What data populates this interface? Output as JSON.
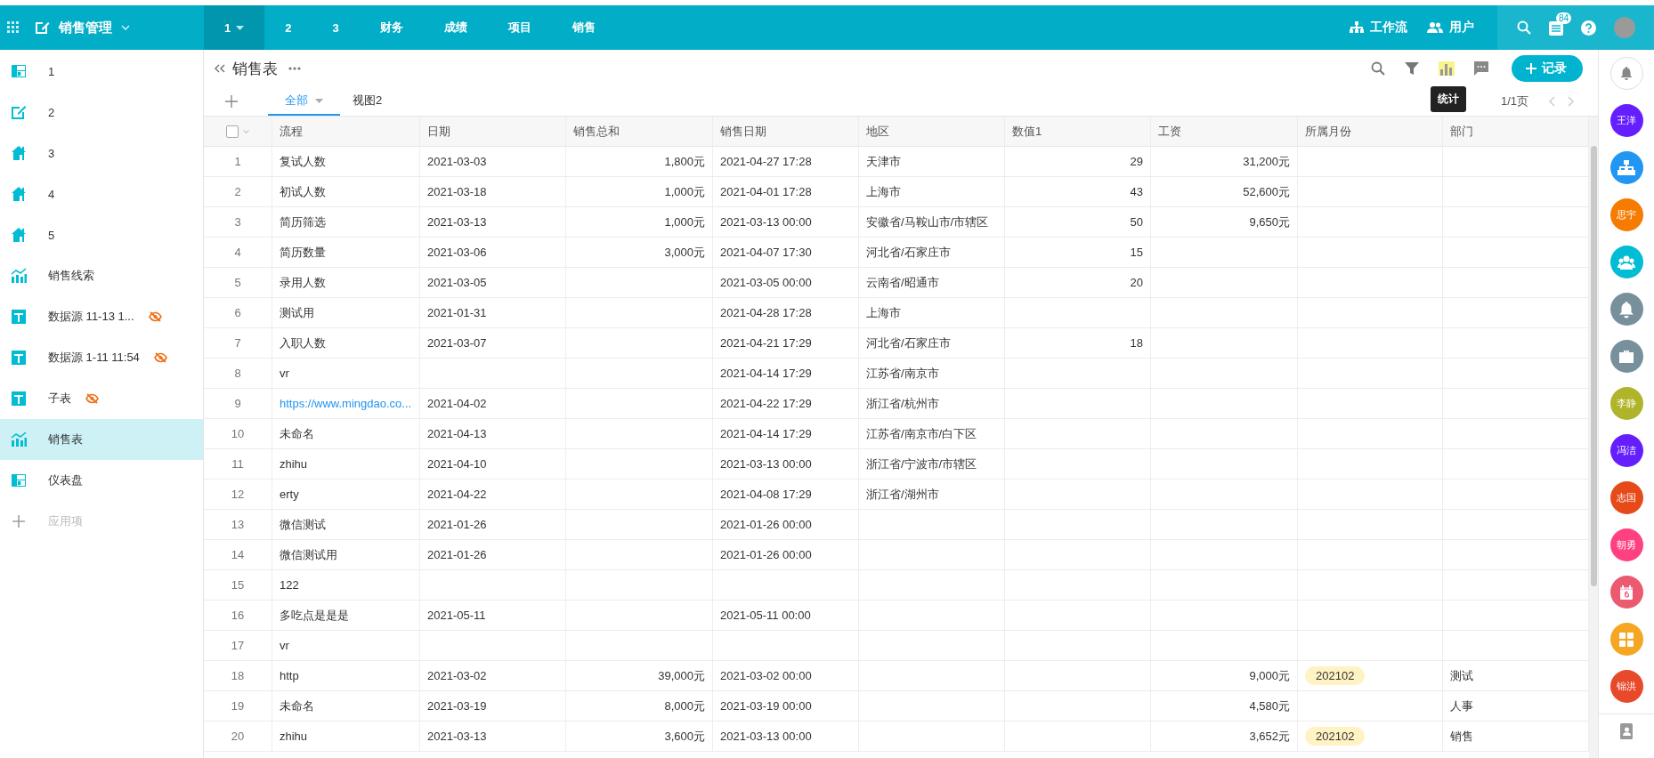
{
  "topbar": {
    "app_name": "销售管理",
    "nav": [
      {
        "label": "1",
        "selected": true
      },
      {
        "label": "2",
        "selected": false
      },
      {
        "label": "3",
        "selected": false
      },
      {
        "label": "财务",
        "selected": false
      },
      {
        "label": "成绩",
        "selected": false
      },
      {
        "label": "项目",
        "selected": false
      },
      {
        "label": "销售",
        "selected": false
      }
    ],
    "links": [
      {
        "kind": "workflow",
        "label": "工作流"
      },
      {
        "kind": "users",
        "label": "用户"
      }
    ],
    "badge": "84"
  },
  "sidebar": {
    "items": [
      {
        "kind": "dashboard",
        "label": "1",
        "hidden": false,
        "selected": false
      },
      {
        "kind": "form",
        "label": "2",
        "hidden": false,
        "selected": false
      },
      {
        "kind": "home",
        "label": "3",
        "hidden": false,
        "selected": false
      },
      {
        "kind": "home",
        "label": "4",
        "hidden": false,
        "selected": false
      },
      {
        "kind": "home",
        "label": "5",
        "hidden": false,
        "selected": false
      },
      {
        "kind": "chart",
        "label": "销售线索",
        "hidden": false,
        "selected": false
      },
      {
        "kind": "table",
        "label": "数据源 11-13 1...",
        "hidden": true,
        "selected": false
      },
      {
        "kind": "table",
        "label": "数据源 1-11 11:54",
        "hidden": true,
        "selected": false
      },
      {
        "kind": "table",
        "label": "子表",
        "hidden": true,
        "selected": false
      },
      {
        "kind": "chart",
        "label": "销售表",
        "hidden": false,
        "selected": true
      },
      {
        "kind": "dashboard",
        "label": "仪表盘",
        "hidden": false,
        "selected": false
      }
    ],
    "add_label": "应用项"
  },
  "view": {
    "title": "销售表",
    "add_record": "记录",
    "tooltip": "统计",
    "tabs": [
      {
        "label": "全部",
        "selected": true
      },
      {
        "label": "视图2",
        "selected": false
      }
    ],
    "pager": "1/1页"
  },
  "table": {
    "select_all_checked": false,
    "columns": [
      {
        "label": "流程",
        "kind": "text"
      },
      {
        "label": "日期",
        "kind": "text"
      },
      {
        "label": "销售总和",
        "kind": "number"
      },
      {
        "label": "销售日期",
        "kind": "text"
      },
      {
        "label": "地区",
        "kind": "text"
      },
      {
        "label": "数值1",
        "kind": "number"
      },
      {
        "label": "工资",
        "kind": "number"
      },
      {
        "label": "所属月份",
        "kind": "tag"
      },
      {
        "label": "部门",
        "kind": "text"
      }
    ],
    "rows": [
      {
        "no": "1",
        "cells": [
          "复试人数",
          "2021-03-03",
          "1,800元",
          "2021-04-27 17:28",
          "天津市",
          "29",
          "31,200元",
          null,
          null
        ]
      },
      {
        "no": "2",
        "cells": [
          "初试人数",
          "2021-03-18",
          "1,000元",
          "2021-04-01 17:28",
          "上海市",
          "43",
          "52,600元",
          null,
          null
        ]
      },
      {
        "no": "3",
        "cells": [
          "简历筛选",
          "2021-03-13",
          "1,000元",
          "2021-03-13 00:00",
          "安徽省/马鞍山市/市辖区",
          "50",
          "9,650元",
          null,
          null
        ]
      },
      {
        "no": "4",
        "cells": [
          "简历数量",
          "2021-03-06",
          "3,000元",
          "2021-04-07 17:30",
          "河北省/石家庄市",
          "15",
          null,
          null,
          null
        ]
      },
      {
        "no": "5",
        "cells": [
          "录用人数",
          "2021-03-05",
          null,
          "2021-03-05 00:00",
          "云南省/昭通市",
          "20",
          null,
          null,
          null
        ]
      },
      {
        "no": "6",
        "cells": [
          "测试用",
          "2021-01-31",
          null,
          "2021-04-28 17:28",
          "上海市",
          null,
          null,
          null,
          null
        ]
      },
      {
        "no": "7",
        "cells": [
          "入职人数",
          "2021-03-07",
          null,
          "2021-04-21 17:29",
          "河北省/石家庄市",
          "18",
          null,
          null,
          null
        ]
      },
      {
        "no": "8",
        "cells": [
          "vr",
          null,
          null,
          "2021-04-14 17:29",
          "江苏省/南京市",
          null,
          null,
          null,
          null
        ]
      },
      {
        "no": "9",
        "cells": [
          {
            "text": "https://www.mingdao.co...",
            "kind": "link"
          },
          "2021-04-02",
          null,
          "2021-04-22 17:29",
          "浙江省/杭州市",
          null,
          null,
          null,
          null
        ]
      },
      {
        "no": "10",
        "cells": [
          "未命名",
          "2021-04-13",
          null,
          "2021-04-14 17:29",
          "江苏省/南京市/白下区",
          null,
          null,
          null,
          null
        ]
      },
      {
        "no": "11",
        "cells": [
          "zhihu",
          "2021-04-10",
          null,
          "2021-03-13 00:00",
          "浙江省/宁波市/市辖区",
          null,
          null,
          null,
          null
        ]
      },
      {
        "no": "12",
        "cells": [
          "erty",
          "2021-04-22",
          null,
          "2021-04-08 17:29",
          "浙江省/湖州市",
          null,
          null,
          null,
          null
        ]
      },
      {
        "no": "13",
        "cells": [
          "微信测试",
          "2021-01-26",
          null,
          "2021-01-26 00:00",
          null,
          null,
          null,
          null,
          null
        ]
      },
      {
        "no": "14",
        "cells": [
          "微信测试用",
          "2021-01-26",
          null,
          "2021-01-26 00:00",
          null,
          null,
          null,
          null,
          null
        ]
      },
      {
        "no": "15",
        "cells": [
          "122",
          null,
          null,
          null,
          null,
          null,
          null,
          null,
          null
        ]
      },
      {
        "no": "16",
        "cells": [
          "多吃点是是是",
          "2021-05-11",
          null,
          "2021-05-11 00:00",
          null,
          null,
          null,
          null,
          null
        ]
      },
      {
        "no": "17",
        "cells": [
          "vr",
          null,
          null,
          null,
          null,
          null,
          null,
          null,
          null
        ]
      },
      {
        "no": "18",
        "cells": [
          "http",
          "2021-03-02",
          "39,000元",
          "2021-03-02 00:00",
          null,
          null,
          "9,000元",
          "202102",
          "测试"
        ]
      },
      {
        "no": "19",
        "cells": [
          "未命名",
          "2021-03-19",
          "8,000元",
          "2021-03-19 00:00",
          null,
          null,
          "4,580元",
          null,
          "人事"
        ]
      },
      {
        "no": "20",
        "cells": [
          "zhihu",
          "2021-03-13",
          "3,600元",
          "2021-03-13 00:00",
          null,
          null,
          "3,652元",
          "202102",
          "销售"
        ]
      }
    ]
  },
  "rail": [
    {
      "kind": "bell-outline"
    },
    {
      "kind": "avatar",
      "text": "王洋",
      "color": "#651fff"
    },
    {
      "kind": "org",
      "color": "#2196f3"
    },
    {
      "kind": "avatar",
      "text": "思宇",
      "color": "#f57c00"
    },
    {
      "kind": "group",
      "color": "#00bcd4"
    },
    {
      "kind": "bell",
      "color": "#78909c"
    },
    {
      "kind": "briefcase",
      "color": "#78909c"
    },
    {
      "kind": "avatar",
      "text": "李静",
      "color": "#afb42b"
    },
    {
      "kind": "avatar",
      "text": "冯洁",
      "color": "#651fff"
    },
    {
      "kind": "avatar",
      "text": "志国",
      "color": "#e64a19"
    },
    {
      "kind": "avatar",
      "text": "朝勇",
      "color": "#ff4081"
    },
    {
      "kind": "calendar",
      "color": "#eb5a6e"
    },
    {
      "kind": "apps",
      "color": "#f5a623"
    },
    {
      "kind": "avatar",
      "text": "锦洪",
      "color": "#e8492a"
    }
  ]
}
